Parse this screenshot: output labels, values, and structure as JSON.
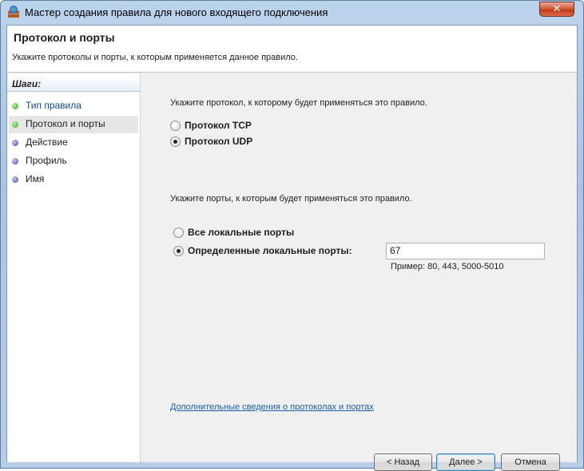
{
  "window": {
    "title": "Мастер создания правила для нового входящего подключения",
    "close_label": "✕"
  },
  "header": {
    "title": "Протокол и порты",
    "subtitle": "Укажите протоколы и порты, к которым применяется данное правило."
  },
  "sidebar": {
    "heading": "Шаги:",
    "steps": [
      {
        "label": "Тип правила",
        "state": "done"
      },
      {
        "label": "Протокол и порты",
        "state": "current"
      },
      {
        "label": "Действие",
        "state": "pending"
      },
      {
        "label": "Профиль",
        "state": "pending"
      },
      {
        "label": "Имя",
        "state": "pending"
      }
    ]
  },
  "main": {
    "protocol_prompt": "Укажите протокол, к которому будет применяться это правило.",
    "protocols": [
      {
        "label": "Протокол TCP",
        "selected": false
      },
      {
        "label": "Протокол UDP",
        "selected": true
      }
    ],
    "ports_prompt": "Укажите порты, к которым будет применяться это правило.",
    "port_options": [
      {
        "label": "Все локальные порты",
        "selected": false
      },
      {
        "label": "Определенные локальные порты:",
        "selected": true
      }
    ],
    "port_value": "67",
    "port_example": "Пример: 80, 443, 5000-5010",
    "more_info_link": "Дополнительные сведения о протоколах и портах"
  },
  "buttons": {
    "back": "< Назад",
    "next": "Далее >",
    "cancel": "Отмена"
  },
  "colors": {
    "link": "#1a5ea8",
    "done_dot": "#3aa31c",
    "pending_dot": "#4a4aa8"
  }
}
